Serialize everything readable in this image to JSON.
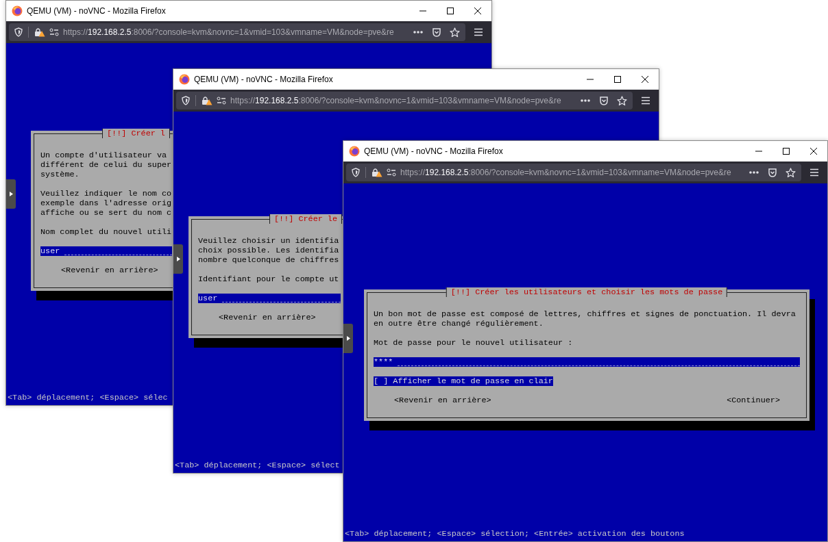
{
  "windows": [
    {
      "title": "QEMU (VM) - noVNC - Mozilla Firefox",
      "url": {
        "scheme": "https://",
        "host": "192.168.2.5",
        "rest": ":8006/?console=kvm&novnc=1&vmid=103&vmname=VM&node=pve&re"
      },
      "dialog": {
        "title": "[!!] Créer l",
        "paragraphs": [
          [
            "Un compte d'utilisateur va",
            "différent de celui du super",
            "système."
          ],
          [
            "Veuillez indiquer le nom co",
            "exemple dans l'adresse orig",
            "affiche ou se sert du nom c"
          ]
        ],
        "prompt": "Nom complet du nouvel utili",
        "field": {
          "value": "user"
        },
        "buttons": [
          "<Revenir en arrière>"
        ]
      },
      "status_bar": "<Tab> déplacement; <Espace> sélec"
    },
    {
      "title": "QEMU (VM) - noVNC - Mozilla Firefox",
      "url": {
        "scheme": "https://",
        "host": "192.168.2.5",
        "rest": ":8006/?console=kvm&novnc=1&vmid=103&vmname=VM&node=pve&re"
      },
      "dialog": {
        "title": "[!!] Créer le",
        "paragraphs": [
          [
            "Veuillez choisir un identifia",
            "choix possible. Les identifia",
            "nombre quelconque de chiffres"
          ]
        ],
        "prompt": "Identifiant pour le compte ut",
        "field": {
          "value": "user"
        },
        "buttons": [
          "<Revenir en arrière>"
        ]
      },
      "status_bar": "<Tab> déplacement; <Espace> sélect"
    },
    {
      "title": "QEMU (VM) - noVNC - Mozilla Firefox",
      "url": {
        "scheme": "https://",
        "host": "192.168.2.5",
        "rest": ":8006/?console=kvm&novnc=1&vmid=103&vmname=VM&node=pve&re"
      },
      "dialog": {
        "title": "[!!] Créer les utilisateurs et choisir les mots de passe",
        "paragraphs": [
          [
            "Un bon mot de passe est composé de lettres, chiffres et signes de ponctuation. Il devra",
            "en outre être changé régulièrement."
          ]
        ],
        "prompt": "Mot de passe pour le nouvel utilisateur :",
        "field": {
          "value": "****"
        },
        "checkbox": {
          "label": "[ ] Afficher le mot de passe en clair",
          "selected": true
        },
        "buttons": [
          "<Revenir en arrière>",
          "<Continuer>"
        ]
      },
      "status_bar": "<Tab> déplacement; <Espace> sélection; <Entrée> activation des boutons"
    }
  ]
}
